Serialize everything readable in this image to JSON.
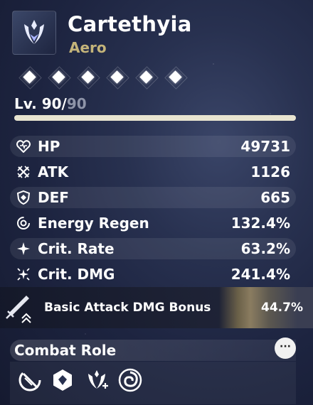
{
  "character": {
    "name": "Cartethyia",
    "element": "Aero",
    "emblem_icon": "aero-emblem-icon"
  },
  "sequence": {
    "nodes": 6,
    "unlocked": 6,
    "icon": "diamond-icon"
  },
  "level": {
    "label": "Lv. 90",
    "separator": "/",
    "max": "90",
    "progress_fraction": 1.0
  },
  "stats": [
    {
      "label": "HP",
      "value": "49731",
      "icon": "heart-icon"
    },
    {
      "label": "ATK",
      "value": "1126",
      "icon": "crossed-swords-icon"
    },
    {
      "label": "DEF",
      "value": "665",
      "icon": "shield-icon"
    },
    {
      "label": "Energy Regen",
      "value": "132.4%",
      "icon": "energy-regen-icon"
    },
    {
      "label": "Crit. Rate",
      "value": "63.2%",
      "icon": "crit-rate-icon"
    },
    {
      "label": "Crit. DMG",
      "value": "241.4%",
      "icon": "crit-dmg-icon"
    }
  ],
  "bonus": {
    "label": "Basic Attack DMG Bonus",
    "value": "44.7%",
    "icon": "sword-icon"
  },
  "combat_role": {
    "title": "Combat Role",
    "more_label": "···",
    "roles": [
      "slash-role-icon",
      "hexagon-role-icon",
      "aero-boost-role-icon",
      "spiral-role-icon"
    ]
  },
  "colors": {
    "element_gold": "#c4b47a",
    "level_max_grey": "#8e94a8",
    "bar_fill": "#e8e4d0"
  }
}
